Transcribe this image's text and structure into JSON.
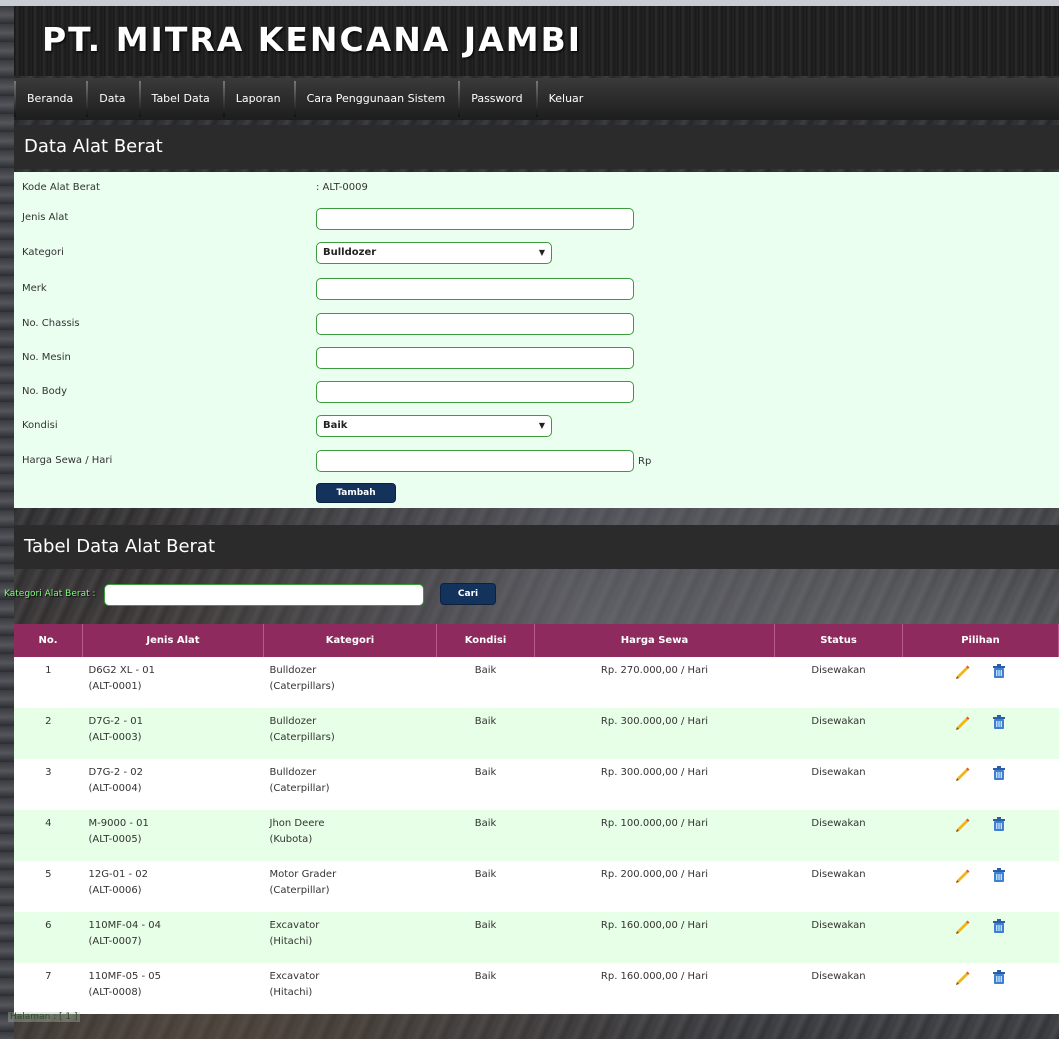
{
  "app": {
    "title": "PT. MITRA KENCANA JAMBI"
  },
  "nav": {
    "items": [
      "Beranda",
      "Data",
      "Tabel Data",
      "Laporan",
      "Cara Penggunaan Sistem",
      "Password",
      "Keluar"
    ]
  },
  "form": {
    "title": "Data Alat Berat",
    "kode_label": "Kode Alat Berat",
    "kode_value": ": ALT-0009",
    "jenis_label": "Jenis Alat",
    "kategori_label": "Kategori",
    "kategori_value": "Bulldozer",
    "merk_label": "Merk",
    "chassis_label": "No. Chassis",
    "mesin_label": "No. Mesin",
    "body_label": "No. Body",
    "kondisi_label": "Kondisi",
    "kondisi_value": "Baik",
    "harga_label": "Harga Sewa / Hari",
    "harga_suffix": "Rp",
    "submit_label": "Tambah"
  },
  "table_section": {
    "title": "Tabel Data Alat Berat",
    "search_label": "Kategori Alat Berat :",
    "search_button": "Cari"
  },
  "table": {
    "headers": [
      "No.",
      "Jenis Alat",
      "Kategori",
      "Kondisi",
      "Harga Sewa",
      "Status",
      "Pilihan"
    ],
    "rows": [
      {
        "no": "1",
        "jenis": "D6G2 XL - 01",
        "kode": "(ALT-0001)",
        "kategori": "Bulldozer",
        "merk": "(Caterpillars)",
        "kondisi": "Baik",
        "harga": "Rp. 270.000,00 / Hari",
        "status": "Disewakan"
      },
      {
        "no": "2",
        "jenis": "D7G-2 - 01",
        "kode": "(ALT-0003)",
        "kategori": "Bulldozer",
        "merk": "(Caterpillars)",
        "kondisi": "Baik",
        "harga": "Rp. 300.000,00 / Hari",
        "status": "Disewakan"
      },
      {
        "no": "3",
        "jenis": "D7G-2 - 02",
        "kode": "(ALT-0004)",
        "kategori": "Bulldozer",
        "merk": "(Caterpillar)",
        "kondisi": "Baik",
        "harga": "Rp. 300.000,00 / Hari",
        "status": "Disewakan"
      },
      {
        "no": "4",
        "jenis": "M-9000 - 01",
        "kode": "(ALT-0005)",
        "kategori": "Jhon Deere",
        "merk": "(Kubota)",
        "kondisi": "Baik",
        "harga": "Rp. 100.000,00 / Hari",
        "status": "Disewakan"
      },
      {
        "no": "5",
        "jenis": "12G-01 - 02",
        "kode": "(ALT-0006)",
        "kategori": "Motor Grader",
        "merk": "(Caterpillar)",
        "kondisi": "Baik",
        "harga": "Rp. 200.000,00 / Hari",
        "status": "Disewakan"
      },
      {
        "no": "6",
        "jenis": "110MF-04 - 04",
        "kode": "(ALT-0007)",
        "kategori": "Excavator",
        "merk": "(Hitachi)",
        "kondisi": "Baik",
        "harga": "Rp. 160.000,00 / Hari",
        "status": "Disewakan"
      },
      {
        "no": "7",
        "jenis": "110MF-05 - 05",
        "kode": "(ALT-0008)",
        "kategori": "Excavator",
        "merk": "(Hitachi)",
        "kondisi": "Baik",
        "harga": "Rp. 160.000,00 / Hari",
        "status": "Disewakan"
      }
    ],
    "row_actions": {
      "edit_icon": "pencil-edit-icon",
      "delete_icon": "trash-delete-icon"
    }
  },
  "footer": {
    "pagination": "Halaman : [ 1 ]"
  },
  "colors": {
    "table_header": "#8f2a5e",
    "form_bg": "#eafff0",
    "row_alt": "#e6ffe6",
    "button": "#13325c",
    "input_border": "#3a9c3a"
  }
}
